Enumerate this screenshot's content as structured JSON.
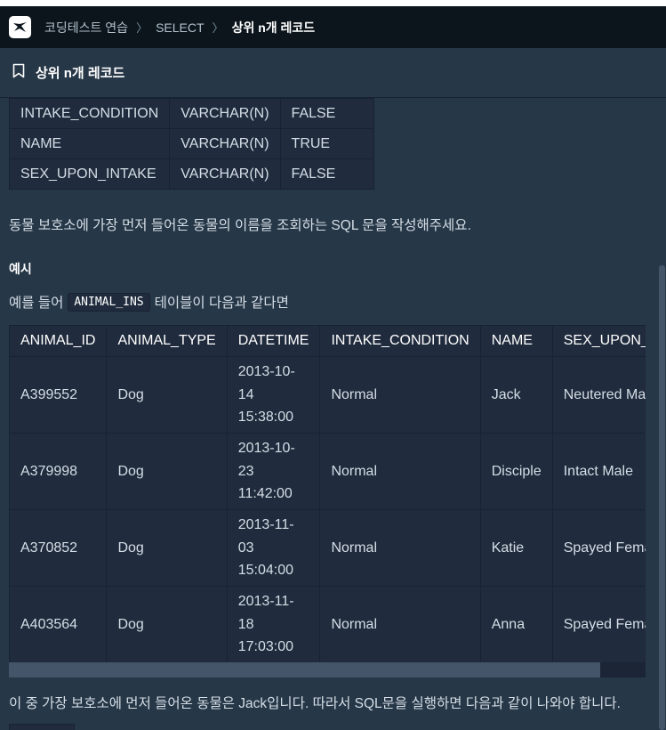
{
  "nav": {
    "breadcrumbs": [
      "코딩테스트 연습",
      "SELECT",
      "상위 n개 레코드"
    ],
    "logo_icon": "programmers-logo-icon"
  },
  "header": {
    "title": "상위 n개 레코드",
    "bookmark_icon": "bookmark-icon"
  },
  "schema_table": {
    "rows": [
      [
        "INTAKE_CONDITION",
        "VARCHAR(N)",
        "FALSE"
      ],
      [
        "NAME",
        "VARCHAR(N)",
        "TRUE"
      ],
      [
        "SEX_UPON_INTAKE",
        "VARCHAR(N)",
        "FALSE"
      ]
    ]
  },
  "problem": {
    "description": "동물 보호소에 가장 먼저 들어온 동물의 이름을 조회하는 SQL 문을 작성해주세요.",
    "example_heading": "예시",
    "intro_before": "예를 들어",
    "intro_code": "ANIMAL_INS",
    "intro_after": "테이블이 다음과 같다면",
    "result_text": "이 중 가장 보호소에 먼저 들어온 동물은 Jack입니다. 따라서 SQL문을 실행하면 다음과 같이 나와야 합니다."
  },
  "example_table": {
    "headers": [
      "ANIMAL_ID",
      "ANIMAL_TYPE",
      "DATETIME",
      "INTAKE_CONDITION",
      "NAME",
      "SEX_UPON_INTAKE"
    ],
    "rows": [
      [
        "A399552",
        "Dog",
        "2013-10-14 15:38:00",
        "Normal",
        "Jack",
        "Neutered Male"
      ],
      [
        "A379998",
        "Dog",
        "2013-10-23 11:42:00",
        "Normal",
        "Disciple",
        "Intact Male"
      ],
      [
        "A370852",
        "Dog",
        "2013-11-03 15:04:00",
        "Normal",
        "Katie",
        "Spayed Female"
      ],
      [
        "A403564",
        "Dog",
        "2013-11-18 17:03:00",
        "Normal",
        "Anna",
        "Spayed Female"
      ]
    ]
  },
  "colors": {
    "bg": "#263747",
    "nav_bg": "#0c151c",
    "table_bg": "#202b3d",
    "border": "#172334"
  }
}
